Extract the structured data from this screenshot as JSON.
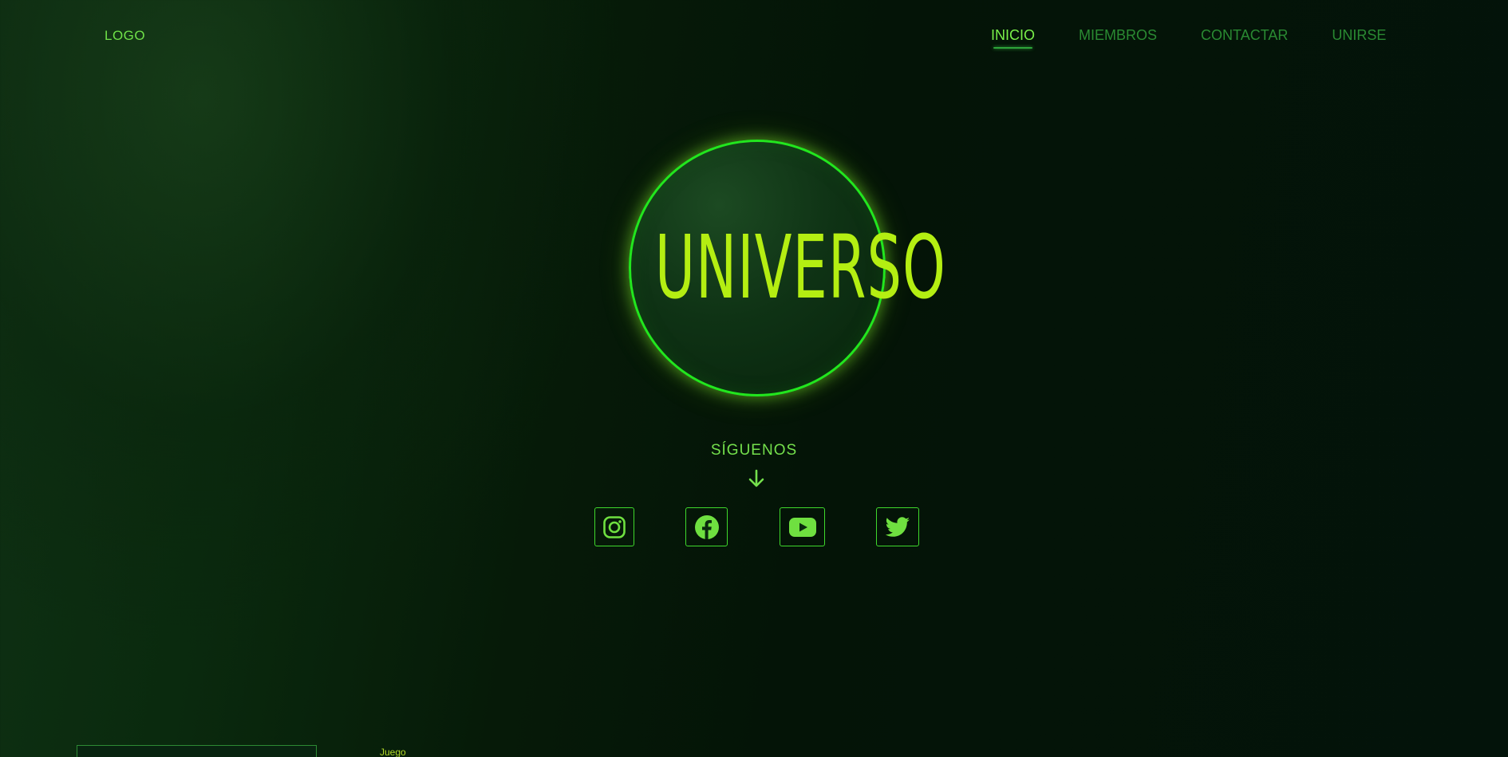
{
  "header": {
    "logo": "LOGO",
    "nav": [
      {
        "label": "INICIO",
        "active": true
      },
      {
        "label": "MIEMBROS",
        "active": false
      },
      {
        "label": "CONTACTAR",
        "active": false
      },
      {
        "label": "UNIRSE",
        "active": false
      }
    ]
  },
  "hero": {
    "title": "UNIVERSO"
  },
  "follow": {
    "label": "SÍGUENOS",
    "arrow_icon": "arrow-down-icon",
    "socials": [
      {
        "name": "instagram-icon"
      },
      {
        "name": "facebook-icon"
      },
      {
        "name": "youtube-icon"
      },
      {
        "name": "twitter-icon"
      }
    ]
  },
  "below_fold": {
    "caption": "Juego"
  },
  "colors": {
    "accent": "#b4ee12",
    "neon_green": "#22e61e",
    "nav_inactive": "#2a8a32",
    "nav_active": "#7af04a",
    "background": "#041407"
  }
}
